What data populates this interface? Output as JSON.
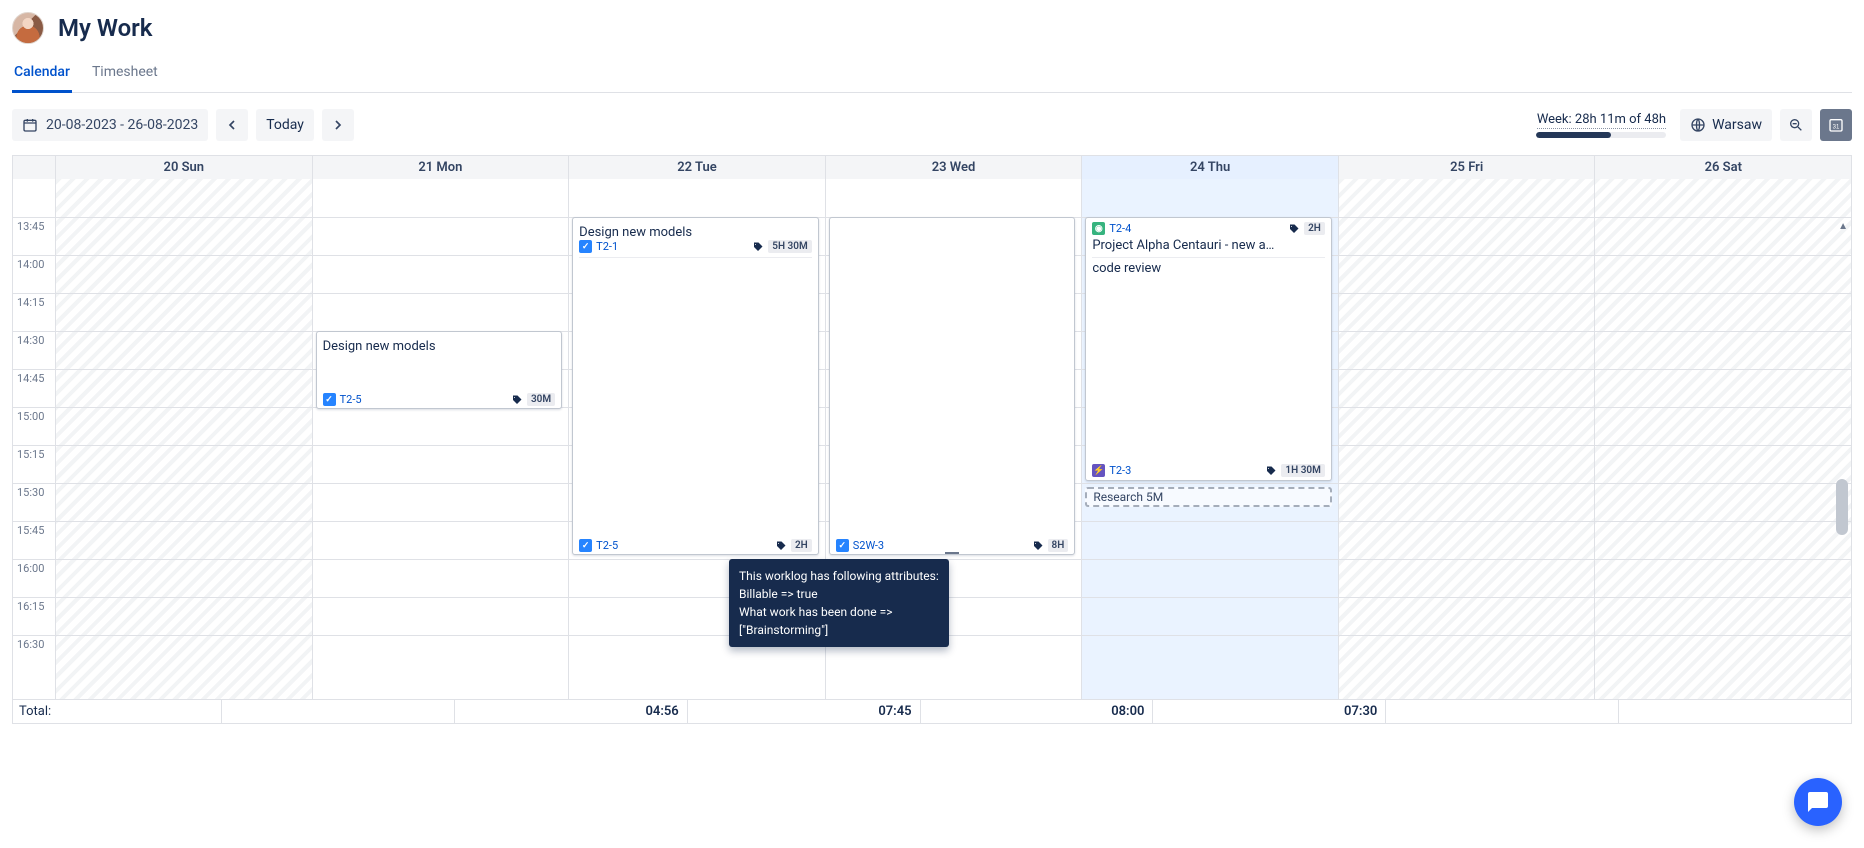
{
  "header": {
    "title": "My Work"
  },
  "tabs": {
    "calendar": "Calendar",
    "timesheet": "Timesheet"
  },
  "toolbar": {
    "range": "20-08-2023 - 26-08-2023",
    "today": "Today",
    "week_summary": "Week: 28h 11m of 48h",
    "progress_percent": 58,
    "timezone": "Warsaw"
  },
  "days": [
    {
      "key": "sun",
      "label": "20 Sun"
    },
    {
      "key": "mon",
      "label": "21 Mon"
    },
    {
      "key": "tue",
      "label": "22 Tue"
    },
    {
      "key": "wed",
      "label": "23 Wed"
    },
    {
      "key": "thu",
      "label": "24 Thu",
      "today": true
    },
    {
      "key": "fri",
      "label": "25 Fri"
    },
    {
      "key": "sat",
      "label": "26 Sat"
    }
  ],
  "time_slots": [
    "13:45",
    "14:00",
    "14:15",
    "14:30",
    "14:45",
    "15:00",
    "15:15",
    "15:30",
    "15:45",
    "16:00",
    "16:15",
    "16:30"
  ],
  "events": {
    "mon_1": {
      "issue": "T2-5",
      "type": "task",
      "title": "Design new models",
      "duration": "30M"
    },
    "tue_1": {
      "issue": "T2-1",
      "type": "task",
      "title": "Design new models",
      "duration": "5H 30M"
    },
    "tue_2": {
      "issue": "T2-5",
      "type": "task",
      "duration": "2H"
    },
    "wed_1": {
      "issue": "S2W-3",
      "type": "task",
      "duration": "8H"
    },
    "thu_1": {
      "issue": "T2-4",
      "type": "story",
      "title": "Project Alpha Centauri - new a…",
      "sub": "code review",
      "duration": "2H"
    },
    "thu_2": {
      "issue": "T2-3",
      "type": "epic",
      "duration": "1H 30M"
    },
    "thu_ghost": {
      "label": "Research 5M"
    }
  },
  "tooltip": {
    "line1": "This worklog has following attributes:",
    "line2": "Billable => true",
    "line3": "What work has been done =>",
    "line4": "[\"Brainstorming\"]"
  },
  "footer": {
    "total_label": "Total:",
    "sun": "",
    "mon": "04:56",
    "tue": "07:45",
    "wed": "08:00",
    "thu": "07:30",
    "fri": "",
    "sat": ""
  }
}
